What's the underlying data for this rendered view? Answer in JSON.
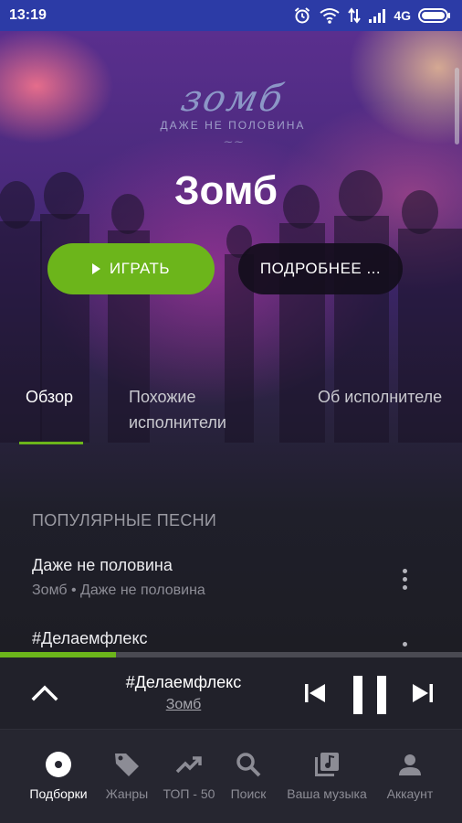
{
  "status_bar": {
    "time": "13:19",
    "network": "4G"
  },
  "hero": {
    "logo_script": "зомб",
    "logo_subtitle": "ДАЖЕ НЕ ПОЛОВИНА",
    "artist_name": "Зомб",
    "play_label": "ИГРАТЬ",
    "more_label": "ПОДРОБНЕЕ ..."
  },
  "tabs": {
    "overview": "Обзор",
    "similar": "Похожие исполнители",
    "about": "Об исполнителе"
  },
  "popular": {
    "header": "ПОПУЛЯРНЫЕ ПЕСНИ",
    "songs": [
      {
        "title": "Даже не половина",
        "subtitle": "Зомб • Даже не половина"
      },
      {
        "title": "#Делаемфлекс"
      }
    ]
  },
  "player": {
    "title": "#Делаемфлекс",
    "artist": "Зомб",
    "progress_fraction": 0.25
  },
  "bottom_nav": {
    "items": [
      {
        "label": "Подборки",
        "icon": "disc-icon",
        "active": true
      },
      {
        "label": "Жанры",
        "icon": "tag-icon"
      },
      {
        "label": "ТОП - 50",
        "icon": "trending-up-icon"
      },
      {
        "label": "Поиск",
        "icon": "search-icon"
      },
      {
        "label": "Ваша музыка",
        "icon": "music-library-icon"
      },
      {
        "label": "Аккаунт",
        "icon": "account-icon"
      }
    ]
  },
  "colors": {
    "accent": "#6cb51b",
    "status_bar": "#2c3ba6",
    "background": "#1d1d24"
  }
}
